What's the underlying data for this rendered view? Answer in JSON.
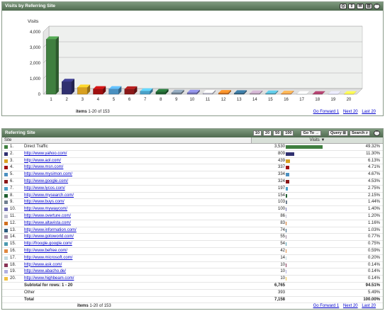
{
  "panel1": {
    "title": "Visits by Referring Site",
    "footer_items_label": "items",
    "footer_items_range": "1-20 of 153",
    "nav": {
      "forward": "Go Forward 1",
      "next": "Next 20",
      "last": "Last 20"
    }
  },
  "chart_data": {
    "type": "bar",
    "title": "Visits",
    "xlabel": "",
    "ylabel": "Visits",
    "ylim": [
      0,
      4000
    ],
    "yticks": [
      "0",
      "1,000",
      "2,000",
      "3,000",
      "4,000"
    ],
    "grid": true,
    "categories": [
      "1",
      "2",
      "3",
      "4",
      "5",
      "6",
      "7",
      "8",
      "9",
      "10",
      "11",
      "12",
      "13",
      "14",
      "15",
      "16",
      "17",
      "18",
      "19",
      "20"
    ],
    "values": [
      3530,
      809,
      439,
      337,
      334,
      324,
      197,
      154,
      103,
      100,
      86,
      83,
      74,
      55,
      54,
      42,
      14,
      10,
      10,
      10
    ],
    "colors": [
      "#3f7f3f",
      "#303070",
      "#d8a020",
      "#a01010",
      "#4a90c0",
      "#8a1818",
      "#4aa0c8",
      "#1f5f2f",
      "#708090",
      "#6f6fb0",
      "#c0c0d0",
      "#d07020",
      "#2f5f7f",
      "#a08aa0",
      "#4a9ab0",
      "#e08840",
      "#c0d8e0",
      "#883355",
      "#b0b0e0",
      "#f0c040"
    ]
  },
  "panel2": {
    "title": "Referring Site",
    "page_sizes": [
      "10",
      "20",
      "50",
      "100"
    ],
    "selected_size": "20",
    "goto_label": "Go To",
    "query_label": "Query",
    "search_label": "Search",
    "col_site": "Site",
    "col_visits": "Visits ▼",
    "rows": [
      {
        "rank": "1.",
        "name": "Direct Traffic",
        "visits": "3,530",
        "pct": "49.32%",
        "link": false
      },
      {
        "rank": "2.",
        "name": "http://www.yahoo.com/",
        "visits": "809",
        "pct": "11.30%",
        "link": true
      },
      {
        "rank": "3.",
        "name": "http://www.aol.com/",
        "visits": "439",
        "pct": "6.13%",
        "link": true
      },
      {
        "rank": "4.",
        "name": "http://www.msn.com/",
        "visits": "337",
        "pct": "4.71%",
        "link": true
      },
      {
        "rank": "5.",
        "name": "http://www.mysimon.com/",
        "visits": "334",
        "pct": "4.67%",
        "link": true
      },
      {
        "rank": "6.",
        "name": "http://www.google.com/",
        "visits": "324",
        "pct": "4.53%",
        "link": true
      },
      {
        "rank": "7.",
        "name": "http://www.lycos.com/",
        "visits": "197",
        "pct": "2.75%",
        "link": true
      },
      {
        "rank": "8.",
        "name": "http://www.mysearch.com/",
        "visits": "154",
        "pct": "2.15%",
        "link": true
      },
      {
        "rank": "9.",
        "name": "http://www.buys.com/",
        "visits": "103",
        "pct": "1.44%",
        "link": true
      },
      {
        "rank": "10.",
        "name": "http://www.mywaycom/",
        "visits": "100",
        "pct": "1.40%",
        "link": true
      },
      {
        "rank": "11.",
        "name": "http://www.overture.com/",
        "visits": "86",
        "pct": "1.20%",
        "link": true
      },
      {
        "rank": "12.",
        "name": "http://www.altavista.com/",
        "visits": "83",
        "pct": "1.16%",
        "link": true
      },
      {
        "rank": "13.",
        "name": "http://www.information.com/",
        "visits": "74",
        "pct": "1.03%",
        "link": true
      },
      {
        "rank": "14.",
        "name": "http://www.gotoworld.com/",
        "visits": "55",
        "pct": "0.77%",
        "link": true
      },
      {
        "rank": "15.",
        "name": "http://froogle.google.com/",
        "visits": "54",
        "pct": "0.75%",
        "link": true
      },
      {
        "rank": "16.",
        "name": "http://www.befree.com/",
        "visits": "42",
        "pct": "0.59%",
        "link": true
      },
      {
        "rank": "17.",
        "name": "http://www.microsoft.com/",
        "visits": "14",
        "pct": "0.20%",
        "link": true
      },
      {
        "rank": "18.",
        "name": "http://www.ask.com/",
        "visits": "10",
        "pct": "0.14%",
        "link": true
      },
      {
        "rank": "19.",
        "name": "http://www.abacho.de/",
        "visits": "10",
        "pct": "0.14%",
        "link": true
      },
      {
        "rank": "20.",
        "name": "http://www.highbeam.com/",
        "visits": "10",
        "pct": "0.14%",
        "link": true
      }
    ],
    "subtotal": {
      "label": "Subtotal for rows: 1 - 20",
      "visits": "6,765",
      "pct": "94.51%"
    },
    "other": {
      "label": "Other",
      "visits": "393",
      "pct": "5.49%"
    },
    "total": {
      "label": "Total",
      "visits": "7,158",
      "pct": "100.00%"
    },
    "footer_items_label": "items",
    "footer_items_range": "1-20 of 153",
    "nav": {
      "forward": "Go Forward 1",
      "next": "Next 20",
      "last": "Last 20"
    }
  }
}
